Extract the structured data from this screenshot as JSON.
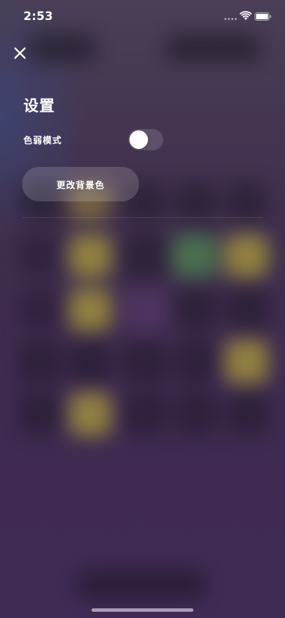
{
  "status_bar": {
    "time": "2:53",
    "icons": [
      "cellular-signal-icon",
      "wifi-icon",
      "battery-icon"
    ]
  },
  "header": {
    "close_icon": "close-icon"
  },
  "settings": {
    "title": "设置",
    "color_weak_mode": {
      "label": "色弱模式",
      "enabled": false
    },
    "change_background_label": "更改背景色"
  },
  "colors": {
    "text": "#ffffff",
    "toggle_off_track": "rgba(255,255,255,0.14)",
    "blurred_yellow": "#b8aa3a",
    "blurred_green": "#4f8a4f"
  }
}
